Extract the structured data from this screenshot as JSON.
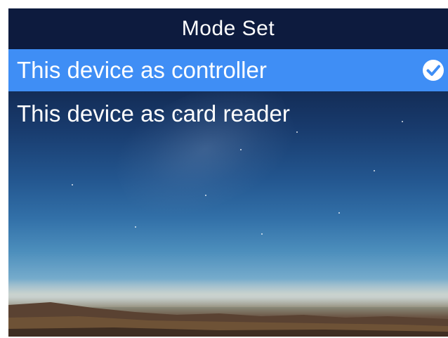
{
  "header": {
    "title": "Mode Set"
  },
  "menu": {
    "items": [
      {
        "label": "This device as controller",
        "selected": true,
        "icon": "checkmark-circle-icon"
      },
      {
        "label": "This device as card reader",
        "selected": false
      }
    ]
  },
  "colors": {
    "header_bg": "#0d1b3e",
    "selected_bg": "#3f8ef5",
    "text": "#ffffff"
  },
  "background": {
    "description_icon": "night-sky-wallpaper"
  }
}
